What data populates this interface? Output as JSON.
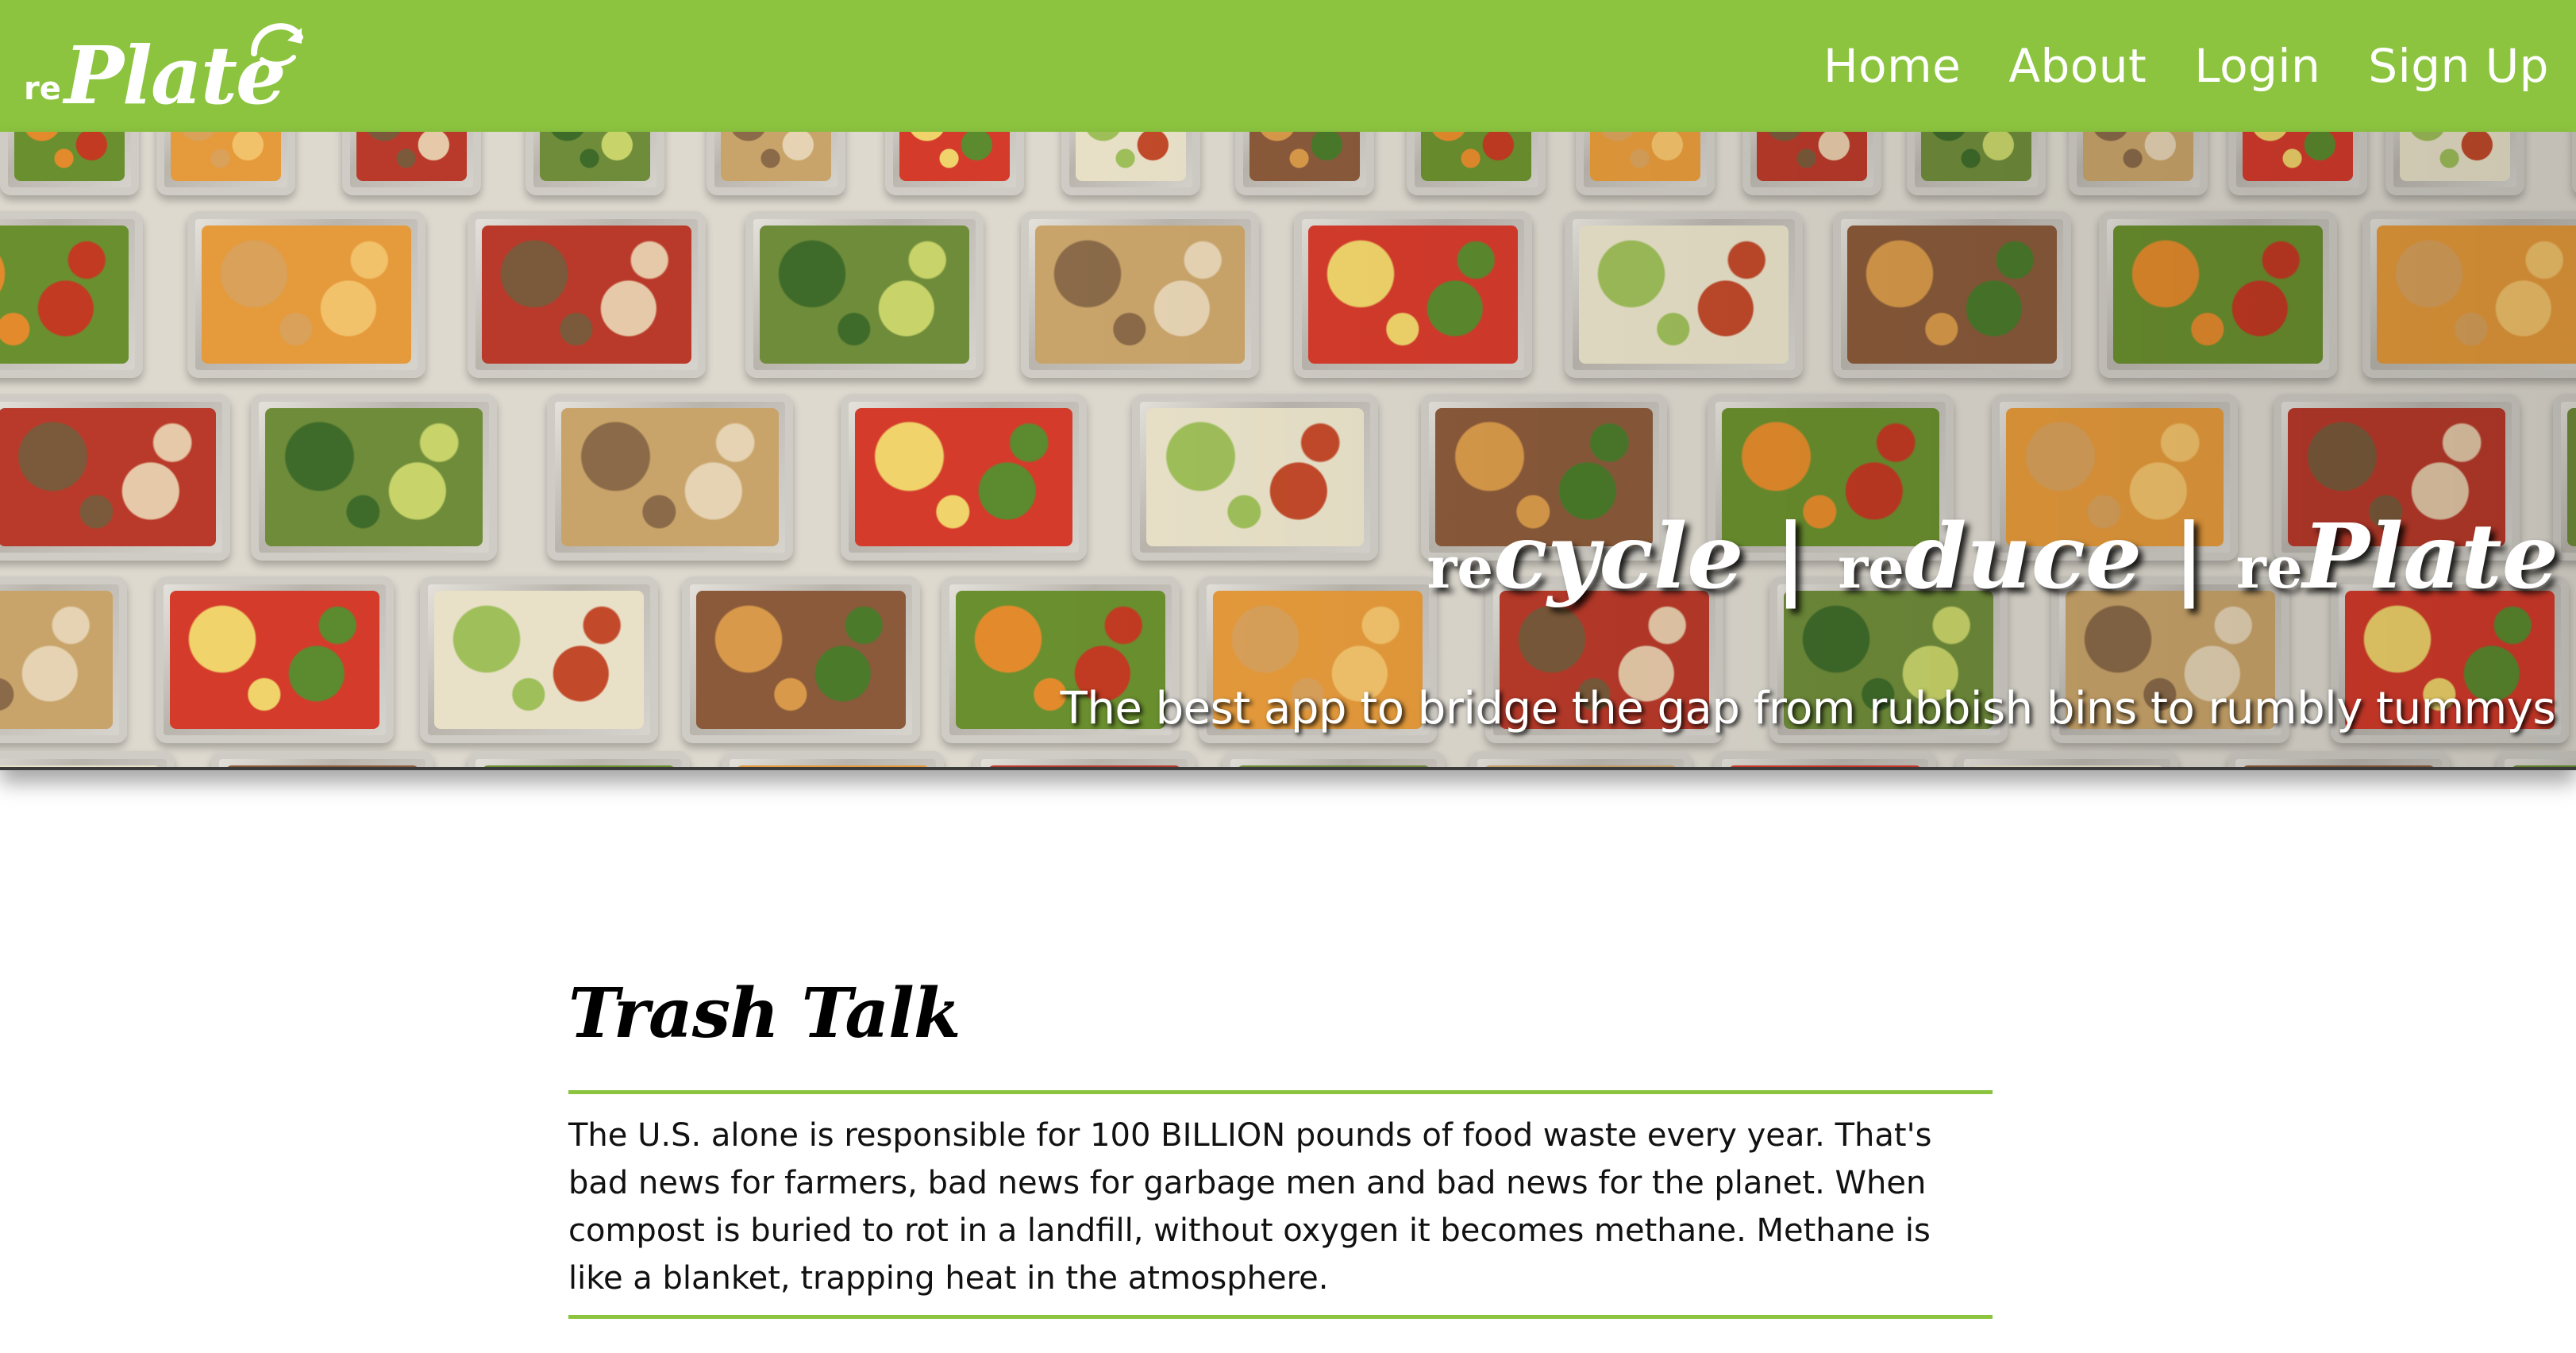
{
  "nav": {
    "logo_prefix": "re",
    "logo_main": "Plate",
    "links": [
      "Home",
      "About",
      "Login",
      "Sign Up"
    ]
  },
  "hero": {
    "tagline_parts": [
      "re",
      "cycle",
      " | ",
      "re",
      "duce",
      " | ",
      "re",
      "Plate"
    ],
    "subtitle": "The best app to bridge the gap from rubbish bins to rumbly tummys"
  },
  "section": {
    "title": "Trash Talk",
    "body": "The U.S. alone is responsible for 100 BILLION pounds of food waste every year. That's bad news for farmers, bad news for garbage men and bad news for the planet. When compost is buried to rot in a landfill, without oxygen it becomes methane. Methane is like a blanket, trapping heat in the atmosphere."
  },
  "colors": {
    "brand_green": "#8cc43f",
    "text_dark": "#111111",
    "white": "#ffffff"
  }
}
